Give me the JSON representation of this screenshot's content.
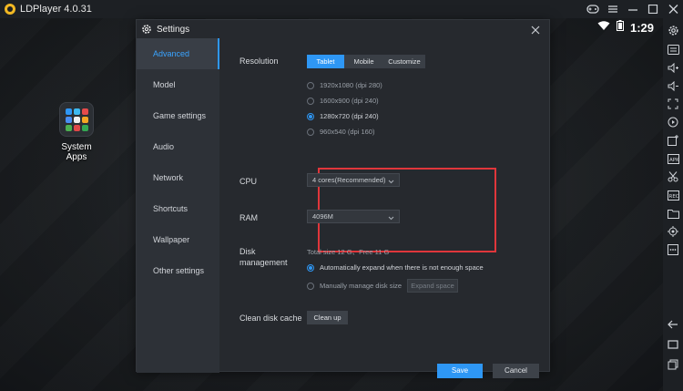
{
  "window": {
    "title": "LDPlayer 4.0.31"
  },
  "statusbar": {
    "time": "1:29"
  },
  "desktop": {
    "system_apps_label": "System Apps"
  },
  "dialog": {
    "title": "Settings",
    "nav": [
      "Advanced",
      "Model",
      "Game settings",
      "Audio",
      "Network",
      "Shortcuts",
      "Wallpaper",
      "Other settings"
    ],
    "active_nav": "Advanced",
    "resolution": {
      "label": "Resolution",
      "tabs": [
        "Tablet",
        "Mobile",
        "Customize"
      ],
      "selected_tab": "Tablet",
      "options": [
        "1920x1080  (dpi 280)",
        "1600x900  (dpi 240)",
        "1280x720  (dpi 240)",
        "960x540  (dpi 160)"
      ],
      "selected_option": "1280x720  (dpi 240)"
    },
    "cpu": {
      "label": "CPU",
      "value": "4 cores(Recommended)"
    },
    "ram": {
      "label": "RAM",
      "value": "4096M"
    },
    "disk": {
      "label_line1": "Disk",
      "label_line2": "management",
      "info": "Total size 12 G、Free 11 G",
      "option_auto": "Automatically expand when there is not enough space",
      "option_manual": "Manually manage disk size",
      "expand_button": "Expand space",
      "selected": "auto"
    },
    "clean": {
      "label": "Clean disk cache",
      "button": "Clean up"
    },
    "footer": {
      "save": "Save",
      "cancel": "Cancel"
    }
  },
  "colors": {
    "accent": "#2e97f5",
    "highlight": "#e0363b",
    "logo": "#f2b823"
  }
}
